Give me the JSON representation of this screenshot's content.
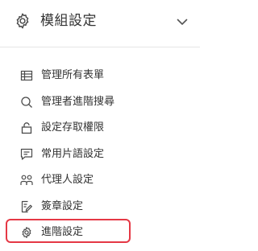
{
  "header": {
    "title": "模組設定",
    "icon": "gear-icon",
    "chevron": "chevron-down-icon"
  },
  "menu": {
    "items": [
      {
        "label": "管理所有表單",
        "icon": "table-icon"
      },
      {
        "label": "管理者進階搜尋",
        "icon": "search-icon"
      },
      {
        "label": "設定存取權限",
        "icon": "lock-icon"
      },
      {
        "label": "常用片語設定",
        "icon": "message-icon"
      },
      {
        "label": "代理人設定",
        "icon": "users-icon"
      },
      {
        "label": "簽章設定",
        "icon": "signature-icon"
      },
      {
        "label": "進階設定",
        "icon": "settings-icon",
        "highlighted": true
      }
    ]
  },
  "colors": {
    "text": "#333333",
    "icon": "#4a4a4a",
    "highlight_border": "#e53845",
    "divider": "#e6e6e6"
  }
}
